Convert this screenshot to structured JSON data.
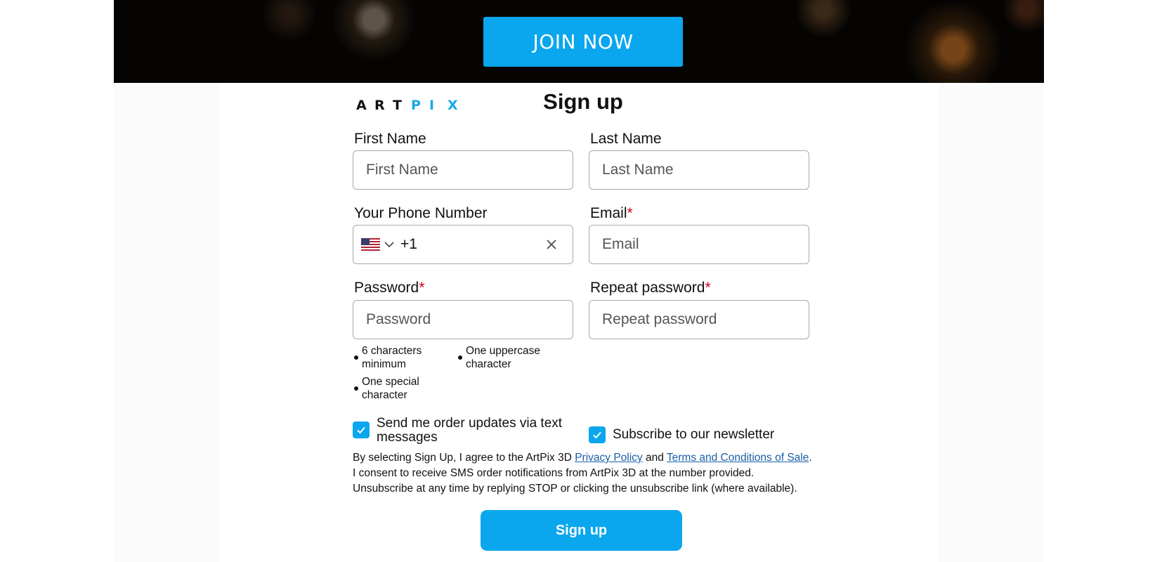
{
  "hero": {
    "join_label": "JOIN NOW"
  },
  "logo": {
    "letters": [
      "A",
      "R",
      "T",
      "P",
      "I",
      "X"
    ]
  },
  "form": {
    "title": "Sign up",
    "first_name": {
      "label": "First Name",
      "placeholder": "First Name"
    },
    "last_name": {
      "label": "Last Name",
      "placeholder": "Last Name"
    },
    "phone": {
      "label": "Your Phone Number",
      "country_code": "+1",
      "flag": "us-flag-icon"
    },
    "email": {
      "label": "Email",
      "required_mark": "*",
      "placeholder": "Email"
    },
    "password": {
      "label": "Password",
      "required_mark": "*",
      "placeholder": "Password"
    },
    "repeat_password": {
      "label": "Repeat password",
      "required_mark": "*",
      "placeholder": "Repeat password"
    },
    "password_hints": [
      {
        "line1": "6 characters",
        "line2": "minimum"
      },
      {
        "line1": "One uppercase",
        "line2": "character"
      },
      {
        "line1": "One special",
        "line2": "character"
      }
    ],
    "sms_checkbox": {
      "label": "Send me order updates via text messages",
      "checked": true
    },
    "newsletter_checkbox": {
      "label": "Subscribe to our newsletter",
      "checked": true
    },
    "legal": {
      "part1": "By selecting Sign Up, I agree to the ArtPix 3D ",
      "privacy_link": "Privacy Policy",
      "part2": " and ",
      "terms_link": "Terms and Conditions of Sale",
      "part3": ". I consent to receive SMS order notifications from ArtPix 3D at the number provided. Unsubscribe at any time by replying STOP or clicking the unsubscribe link (where available)."
    },
    "submit_label": "Sign up"
  },
  "colors": {
    "accent": "#0aa6ee",
    "required": "#d0021b",
    "link": "#1a5fa8",
    "logo_blue": "#17a8e3"
  }
}
